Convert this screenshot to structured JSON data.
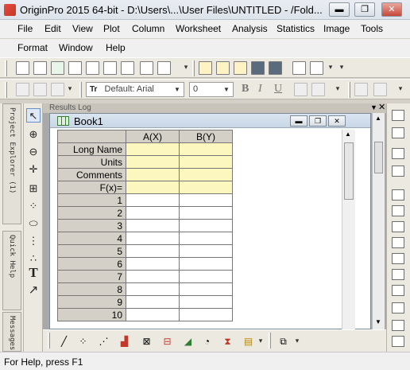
{
  "window": {
    "title": "OriginPro 2015 64-bit - D:\\Users\\...\\User Files\\UNTITLED - /Fold...",
    "minimize_glyph": "▬",
    "restore_glyph": "❐",
    "close_glyph": "✕"
  },
  "menu": {
    "row1": [
      "File",
      "Edit",
      "View",
      "Plot",
      "Column",
      "Worksheet",
      "Analysis",
      "Statistics",
      "Image",
      "Tools"
    ],
    "row2": [
      "Format",
      "Window",
      "Help"
    ]
  },
  "format_toolbar": {
    "font_value": "Default: Arial",
    "font_prefix": "Tr",
    "size_value": "0",
    "bold": "B",
    "italic": "I",
    "underline": "U"
  },
  "left_rail": {
    "tabs": [
      "Project Explorer (1)",
      "Quick Help",
      "Messages"
    ]
  },
  "results_log": {
    "title": "Results Log"
  },
  "book": {
    "name": "Book1",
    "columns": [
      "A(X)",
      "B(Y)"
    ],
    "meta_rows": [
      "Long Name",
      "Units",
      "Comments",
      "F(x)="
    ],
    "rows": [
      "1",
      "2",
      "3",
      "4",
      "5",
      "6",
      "7",
      "8",
      "9",
      "10"
    ]
  },
  "statusbar": {
    "text": "For Help, press F1"
  },
  "icons": {
    "toolbar1": [
      "new-project-icon",
      "new-workbook-icon",
      "new-excel-icon",
      "new-graph-icon",
      "new-matrix-icon",
      "new-function-icon",
      "new-3d-icon",
      "new-layout-icon",
      "new-notes-icon",
      "open-icon",
      "open-template-icon",
      "open-excel-icon",
      "save-icon",
      "save-template-icon",
      "recalculate-icon",
      "import-ascii-icon"
    ],
    "tools": [
      "pointer-icon",
      "zoom-in-icon",
      "zoom-out-icon",
      "data-reader-icon",
      "screen-reader-icon",
      "draw-data-icon",
      "mask-icon",
      "regional-icon",
      "text-tool-icon",
      "arrow-tool-icon"
    ],
    "bottom": [
      "line-plot-icon",
      "scatter-plot-icon",
      "line-symbol-plot-icon",
      "column-plot-icon",
      "contour-icon",
      "box-chart-icon",
      "area-plot-icon",
      "pie-chart-icon",
      "candlestick-icon",
      "3d-bar-icon",
      "template-library-icon"
    ]
  }
}
